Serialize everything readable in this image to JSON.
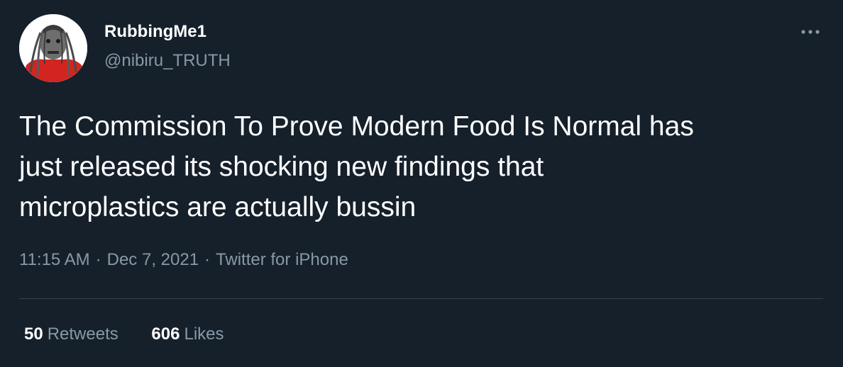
{
  "author": {
    "display_name": "RubbingMe1",
    "handle": "@nibiru_TRUTH"
  },
  "more_icon": "more-horizontal-icon",
  "tweet": {
    "lines": [
      "The Commission To Prove Modern Food Is Normal has",
      "just released its shocking new findings that",
      "microplastics are actually bussin"
    ]
  },
  "meta": {
    "time": "11:15 AM",
    "separator": "·",
    "date": "Dec 7, 2021",
    "source": "Twitter for iPhone"
  },
  "stats": {
    "retweets_count": "50",
    "retweets_label": "Retweets",
    "likes_count": "606",
    "likes_label": "Likes"
  },
  "colors": {
    "background": "#15202b",
    "primary_text": "#ffffff",
    "secondary_text": "#8899a6",
    "divider": "#38444d"
  }
}
